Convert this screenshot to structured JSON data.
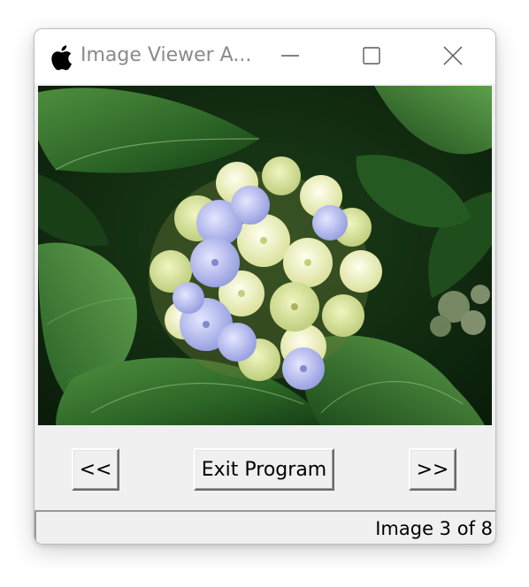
{
  "window": {
    "title": "Image Viewer A...",
    "app_icon": "apple-icon",
    "controls": {
      "minimize_icon": "minimize-icon",
      "maximize_icon": "maximize-icon",
      "close_icon": "close-icon"
    }
  },
  "image": {
    "subject": "hydrangea-photo",
    "colors": {
      "leaf_dark": "#0f2a0f",
      "leaf_mid": "#2e6b2a",
      "leaf_light": "#5c9a4c",
      "petal_blue": "#a7b0e8",
      "petal_cream": "#f2f4c6"
    }
  },
  "controls": {
    "prev_label": "<<",
    "exit_label": "Exit Program",
    "next_label": ">>"
  },
  "status": {
    "text": "Image 3 of 8",
    "current_index": 3,
    "total": 8
  }
}
